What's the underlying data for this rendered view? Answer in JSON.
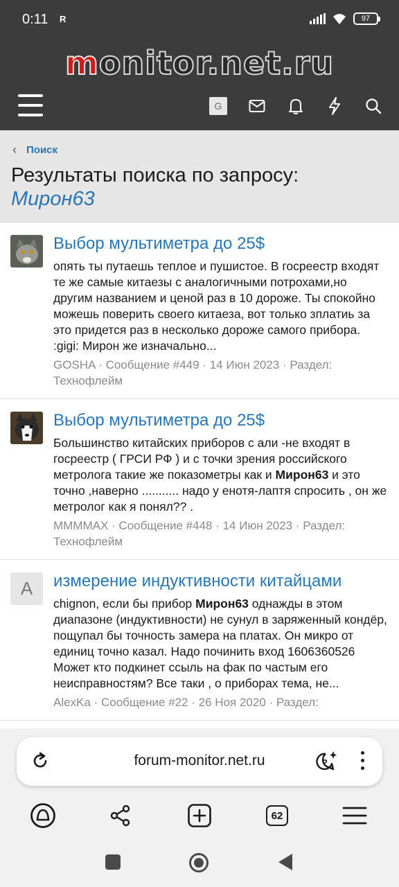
{
  "status": {
    "time": "0:11",
    "sim_icon": "R",
    "battery": "97"
  },
  "site": {
    "logo": "monitor.net.ru",
    "logo_first": "m",
    "logo_rest": "onitor.net.ru"
  },
  "nav": {
    "g_label": "G"
  },
  "breadcrumb": {
    "label": "Поиск"
  },
  "header": {
    "title": "Результаты поиска по запросу:",
    "query": "Мирон63"
  },
  "results": [
    {
      "title": "Выбор мультиметра до 25$",
      "snippet": "опять ты путаешь теплое и пушистое. В госреестр входят те же самые китаезы с аналогичными потрохами,но другим названием и ценой раз в 10 дороже. Ты спокойно можешь поверить своего китаеза, вот только зплатиь за это придется раз в несколько дороже самого прибора. :gigi: Мирон же изначально...",
      "meta": "GOSHA · Сообщение #449 · 14 Июн 2023 · Раздел: Технофлейм"
    },
    {
      "title": "Выбор мультиметра до 25$",
      "snippet_pre": "Большинство китайских приборов с али -не входят в госреестр ( ГРСИ РФ ) и с точки зрения российского метролога такие же показометры как и ",
      "snippet_bold": "Мирон63",
      "snippet_post": " и это точно ,наверно ........... надо у енотя-лаптя спросить , он же метролог как я понял?? .",
      "meta": "MMMMAX · Сообщение #448 · 14 Июн 2023 · Раздел: Технофлейм"
    },
    {
      "avatar_letter": "A",
      "title": "измерение индуктивности китайцами",
      "snippet_pre": "chignon, если бы прибор ",
      "snippet_bold": "Мирон63",
      "snippet_post": " однажды в этом диапазоне (индуктивности) не сунул в заряженный кондёр, пощупал бы точность замера на платах. Он микро от единиц точно казал. Надо починить вход 1606360526 Может кто подкинет ссыль на фак по частым его неисправностям? Все таки , о приборах тема, не...",
      "meta": "AlexKa · Сообщение #22 · 26 Ноя 2020 · Раздел:"
    }
  ],
  "browser": {
    "url": "forum-monitor.net.ru",
    "tab_count": "62"
  }
}
